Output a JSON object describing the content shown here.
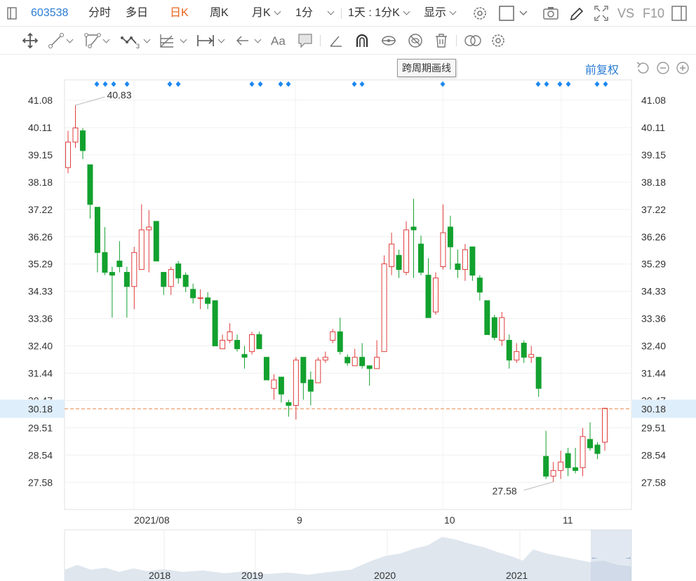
{
  "toolbar": {
    "code": "603538",
    "tabs": [
      "分时",
      "多日",
      "日K",
      "周K",
      "月K",
      "1分",
      "1天 : 1分K",
      "显示"
    ],
    "active_tab": "日K",
    "vs_label": "VS",
    "f10_label": "F10"
  },
  "tooltip": "跨周期画线",
  "adjust_label": "前复权",
  "colors": {
    "up": "#e03c3c",
    "down": "#12a12e",
    "accent": "#2a7cd4",
    "current_line": "#e8864a",
    "active_tab": "#e8641a"
  },
  "current_price_label": "30.18",
  "chart_data": {
    "type": "candlestick",
    "y_ticks": [
      "41.08",
      "40.11",
      "39.15",
      "38.18",
      "37.22",
      "36.26",
      "35.29",
      "34.33",
      "33.36",
      "32.40",
      "31.44",
      "30.47",
      "29.51",
      "28.54",
      "27.58"
    ],
    "ylim": [
      27.58,
      41.08
    ],
    "x_tick_labels": [
      "2021/08",
      "9",
      "10",
      "11"
    ],
    "max_annotation": "40.83",
    "min_annotation": "27.58",
    "current_price": 30.18,
    "candles": [
      {
        "o": 38.7,
        "c": 39.6,
        "h": 40.0,
        "l": 38.5
      },
      {
        "o": 39.6,
        "c": 40.1,
        "h": 40.9,
        "l": 39.4
      },
      {
        "o": 40.0,
        "c": 39.3,
        "h": 40.1,
        "l": 39.0
      },
      {
        "o": 38.8,
        "c": 37.4,
        "h": 38.8,
        "l": 36.9
      },
      {
        "o": 37.3,
        "c": 35.7,
        "h": 37.3,
        "l": 35.0
      },
      {
        "o": 35.7,
        "c": 35.0,
        "h": 36.6,
        "l": 34.9
      },
      {
        "o": 35.0,
        "c": 34.9,
        "h": 35.2,
        "l": 33.4
      },
      {
        "o": 35.4,
        "c": 35.2,
        "h": 36.1,
        "l": 35.0
      },
      {
        "o": 35.0,
        "c": 34.5,
        "h": 35.2,
        "l": 33.4
      },
      {
        "o": 34.5,
        "c": 35.7,
        "h": 35.9,
        "l": 33.7
      },
      {
        "o": 35.1,
        "c": 36.5,
        "h": 37.4,
        "l": 35.1
      },
      {
        "o": 36.5,
        "c": 36.6,
        "h": 37.2,
        "l": 35.0
      },
      {
        "o": 36.8,
        "c": 35.4,
        "h": 36.8,
        "l": 35.4
      },
      {
        "o": 35.0,
        "c": 34.5,
        "h": 35.0,
        "l": 34.2
      },
      {
        "o": 34.5,
        "c": 35.1,
        "h": 35.2,
        "l": 34.2
      },
      {
        "o": 35.3,
        "c": 34.8,
        "h": 35.4,
        "l": 34.6
      },
      {
        "o": 34.9,
        "c": 34.5,
        "h": 35.0,
        "l": 34.3
      },
      {
        "o": 34.4,
        "c": 34.1,
        "h": 34.6,
        "l": 33.9
      },
      {
        "o": 34.1,
        "c": 34.1,
        "h": 34.4,
        "l": 33.7
      },
      {
        "o": 34.1,
        "c": 33.9,
        "h": 34.3,
        "l": 33.7
      },
      {
        "o": 34.0,
        "c": 32.4,
        "h": 34.0,
        "l": 32.4
      },
      {
        "o": 32.3,
        "c": 32.6,
        "h": 32.8,
        "l": 32.3
      },
      {
        "o": 32.6,
        "c": 32.9,
        "h": 33.2,
        "l": 32.5
      },
      {
        "o": 32.6,
        "c": 32.3,
        "h": 32.8,
        "l": 32.2
      },
      {
        "o": 32.1,
        "c": 32.0,
        "h": 32.4,
        "l": 31.6
      },
      {
        "o": 32.2,
        "c": 32.8,
        "h": 32.9,
        "l": 32.1
      },
      {
        "o": 32.8,
        "c": 32.3,
        "h": 32.9,
        "l": 32.3
      },
      {
        "o": 32.0,
        "c": 31.2,
        "h": 32.0,
        "l": 31.2
      },
      {
        "o": 30.9,
        "c": 31.2,
        "h": 31.4,
        "l": 30.5
      },
      {
        "o": 31.3,
        "c": 30.7,
        "h": 31.3,
        "l": 30.4
      },
      {
        "o": 30.4,
        "c": 30.3,
        "h": 30.5,
        "l": 29.9
      },
      {
        "o": 30.3,
        "c": 31.9,
        "h": 32.0,
        "l": 29.8
      },
      {
        "o": 32.0,
        "c": 31.1,
        "h": 32.0,
        "l": 30.5
      },
      {
        "o": 31.2,
        "c": 30.8,
        "h": 31.5,
        "l": 30.3
      },
      {
        "o": 31.1,
        "c": 31.9,
        "h": 32.0,
        "l": 31.1
      },
      {
        "o": 31.9,
        "c": 32.0,
        "h": 32.2,
        "l": 31.8
      },
      {
        "o": 32.6,
        "c": 32.9,
        "h": 33.0,
        "l": 32.5
      },
      {
        "o": 32.9,
        "c": 32.2,
        "h": 33.4,
        "l": 32.1
      },
      {
        "o": 32.0,
        "c": 31.8,
        "h": 32.1,
        "l": 31.7
      },
      {
        "o": 31.7,
        "c": 32.0,
        "h": 32.3,
        "l": 31.7
      },
      {
        "o": 32.0,
        "c": 31.7,
        "h": 32.5,
        "l": 31.6
      },
      {
        "o": 31.7,
        "c": 31.6,
        "h": 31.7,
        "l": 31.0
      },
      {
        "o": 31.6,
        "c": 32.0,
        "h": 32.6,
        "l": 31.6
      },
      {
        "o": 32.2,
        "c": 35.3,
        "h": 35.6,
        "l": 32.2
      },
      {
        "o": 35.2,
        "c": 36.0,
        "h": 36.4,
        "l": 34.9
      },
      {
        "o": 35.6,
        "c": 35.1,
        "h": 35.8,
        "l": 34.8
      },
      {
        "o": 35.0,
        "c": 36.5,
        "h": 36.8,
        "l": 34.9
      },
      {
        "o": 36.6,
        "c": 36.5,
        "h": 37.6,
        "l": 34.8
      },
      {
        "o": 36.0,
        "c": 35.0,
        "h": 36.3,
        "l": 34.9
      },
      {
        "o": 34.9,
        "c": 33.4,
        "h": 35.5,
        "l": 33.4
      },
      {
        "o": 33.6,
        "c": 34.8,
        "h": 35.0,
        "l": 33.5
      },
      {
        "o": 35.2,
        "c": 36.4,
        "h": 37.4,
        "l": 35.1
      },
      {
        "o": 36.6,
        "c": 35.9,
        "h": 37.0,
        "l": 35.1
      },
      {
        "o": 35.3,
        "c": 35.1,
        "h": 35.8,
        "l": 34.8
      },
      {
        "o": 35.1,
        "c": 35.8,
        "h": 36.0,
        "l": 34.7
      },
      {
        "o": 35.9,
        "c": 34.9,
        "h": 35.9,
        "l": 34.7
      },
      {
        "o": 34.8,
        "c": 34.3,
        "h": 34.9,
        "l": 34.0
      },
      {
        "o": 34.0,
        "c": 32.8,
        "h": 34.0,
        "l": 32.8
      },
      {
        "o": 33.4,
        "c": 32.7,
        "h": 33.5,
        "l": 32.6
      },
      {
        "o": 32.6,
        "c": 33.4,
        "h": 33.6,
        "l": 32.4
      },
      {
        "o": 32.6,
        "c": 31.9,
        "h": 32.8,
        "l": 31.6
      },
      {
        "o": 31.9,
        "c": 32.2,
        "h": 32.5,
        "l": 31.8
      },
      {
        "o": 32.5,
        "c": 32.0,
        "h": 32.6,
        "l": 31.8
      },
      {
        "o": 32.0,
        "c": 32.1,
        "h": 32.4,
        "l": 31.8
      },
      {
        "o": 32.0,
        "c": 30.9,
        "h": 32.0,
        "l": 30.6
      },
      {
        "o": 28.5,
        "c": 27.8,
        "h": 29.4,
        "l": 27.7
      },
      {
        "o": 27.8,
        "c": 28.0,
        "h": 28.3,
        "l": 27.6
      },
      {
        "o": 28.0,
        "c": 28.3,
        "h": 28.7,
        "l": 27.7
      },
      {
        "o": 28.6,
        "c": 28.1,
        "h": 28.8,
        "l": 27.8
      },
      {
        "o": 28.1,
        "c": 28.0,
        "h": 28.8,
        "l": 27.9
      },
      {
        "o": 28.1,
        "c": 29.2,
        "h": 29.5,
        "l": 27.8
      },
      {
        "o": 29.1,
        "c": 28.8,
        "h": 29.7,
        "l": 28.7
      },
      {
        "o": 28.9,
        "c": 28.6,
        "h": 29.0,
        "l": 28.4
      },
      {
        "o": 29.0,
        "c": 30.2,
        "h": 30.2,
        "l": 28.7
      }
    ],
    "navigator": {
      "year_labels": [
        "2018",
        "2019",
        "2020",
        "2021"
      ]
    }
  }
}
